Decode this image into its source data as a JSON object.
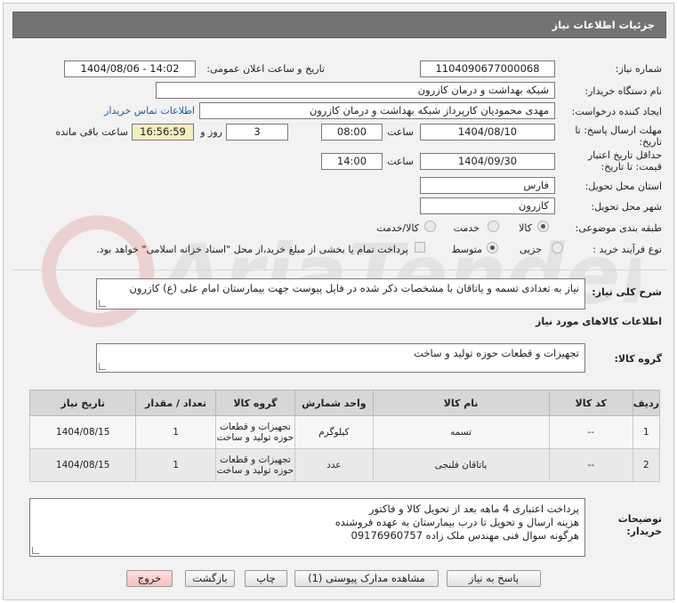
{
  "header": {
    "title": "جزئیات اطلاعات نیاز"
  },
  "fields": {
    "need_number_label": "شماره نیاز:",
    "need_number": "1104090677000068",
    "announce_label": "تاریخ و ساعت اعلان عمومی:",
    "announce_value": "1404/08/06 - 14:02",
    "buyer_org_label": "نام دستگاه خریدار:",
    "buyer_org": "شبکه بهداشت و درمان کازرون",
    "creator_label": "ایجاد کننده درخواست:",
    "creator": "مهدی محمودیان کارپرداز شبکه بهداشت و درمان کازرون",
    "contact_link": "اطلاعات تماس خریدار",
    "deadline_label_1": "مهلت ارسال پاسخ: تا",
    "deadline_label_2": "تاریخ:",
    "deadline_date": "1404/08/10",
    "time_label": "ساعت",
    "deadline_time": "08:00",
    "days_value": "3",
    "days_label": "روز و",
    "remaining_time": "16:56:59",
    "remaining_label": "ساعت باقی مانده",
    "validity_label_1": "حداقل تاریخ اعتبار",
    "validity_label_2": "قیمت: تا تاریخ:",
    "validity_date": "1404/09/30",
    "validity_time_label": "ساعت",
    "validity_time": "14:00",
    "province_label": "استان محل تحویل:",
    "province": "فارس",
    "city_label": "شهر محل تحویل:",
    "city": "کازرون",
    "category_label": "طبقه بندی موضوعی:",
    "category_options": [
      "کالا",
      "خدمت",
      "کالا/خدمت"
    ],
    "purchase_type_label": "نوع فرآیند خرید :",
    "purchase_options": [
      "جزیی",
      "متوسط"
    ],
    "payment_note": "پرداخت تمام یا بخشی از مبلغ خرید،از محل \"اسناد خزانه اسلامی\" خواهد بود."
  },
  "description": {
    "label": "شرح کلی نیاز:",
    "text": "نیاز به تعدادی تسمه و یاتاقان با مشخصات ذکر شده در فایل پیوست جهت بیمارستان امام علی (ع) کازرون"
  },
  "goods_section": {
    "title": "اطلاعات کالاهای مورد نیاز",
    "group_label": "گروه کالا:",
    "group_value": "تجهیزات و قطعات حوزه تولید و ساخت"
  },
  "table": {
    "headers": [
      "ردیف",
      "کد کالا",
      "نام کالا",
      "واحد شمارش",
      "گروه کالا",
      "تعداد / مقدار",
      "تاریخ نیاز"
    ],
    "rows": [
      [
        "1",
        "--",
        "تسمه",
        "کیلوگرم",
        "تجهیزات و قطعات حوزه تولید و ساخت",
        "1",
        "1404/08/15"
      ],
      [
        "2",
        "--",
        "یاتاقان فلنجی",
        "عدد",
        "تجهیزات و قطعات حوزه تولید و ساخت",
        "1",
        "1404/08/15"
      ]
    ]
  },
  "buyer_notes": {
    "label_1": "توضیحات",
    "label_2": "خریدار:",
    "lines": [
      "پرداخت اعتباری 4 ماهه بعد از تحویل کالا و فاکتور",
      "هزینه ارسال و تحویل تا درب بیمارستان به عهده فروشنده",
      "هرگونه سوال فنی مهندس ملک زاده 09176960757"
    ]
  },
  "buttons": {
    "reply": "پاسخ به نیاز",
    "attachments": "مشاهده مدارک پیوستی (1)",
    "print": "چاپ",
    "back": "بازگشت",
    "exit": "خروج"
  },
  "colors": {
    "header_bg": "#737373",
    "link": "#1a5ea8",
    "remaining_bg": "#f2eebd",
    "exit_bg": "#f5c0c0"
  }
}
